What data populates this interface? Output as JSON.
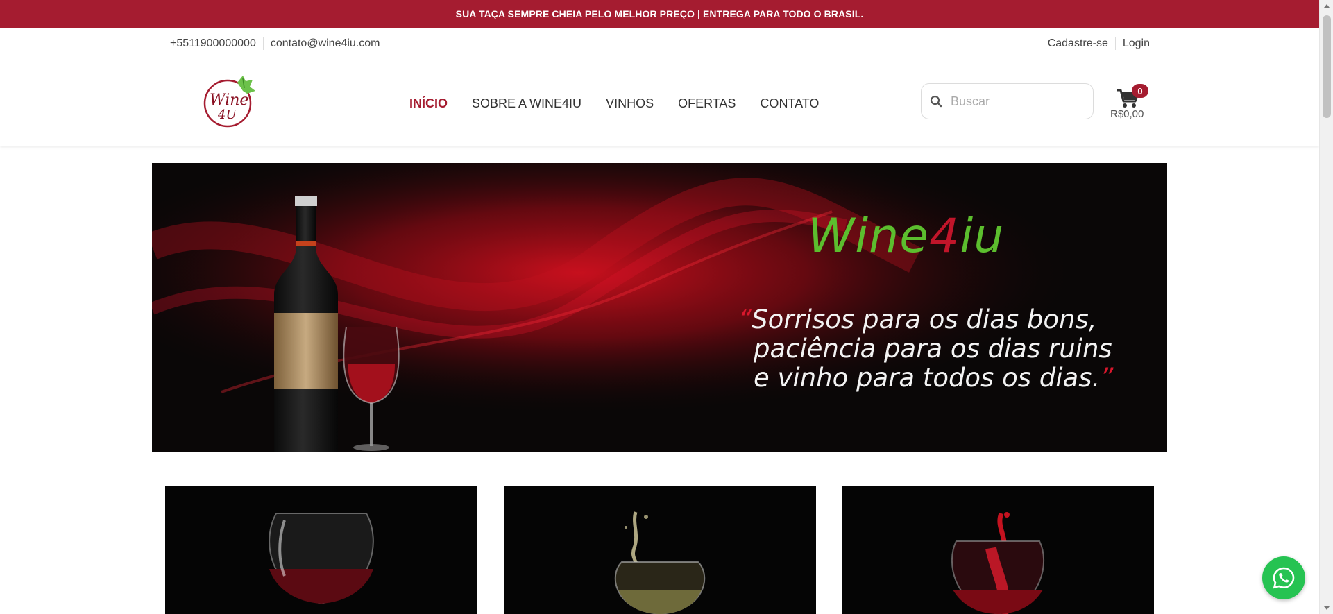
{
  "topbar": {
    "text": "SUA TAÇA SEMPRE CHEIA PELO MELHOR PREÇO | ENTREGA PARA TODO O BRASIL."
  },
  "contact": {
    "phone": "+5511900000000",
    "email": "contato@wine4iu.com"
  },
  "account": {
    "signup": "Cadastre-se",
    "login": "Login"
  },
  "nav": [
    {
      "label": "INÍCIO",
      "active": true
    },
    {
      "label": "SOBRE A WINE4IU",
      "active": false
    },
    {
      "label": "VINHOS",
      "active": false
    },
    {
      "label": "OFERTAS",
      "active": false
    },
    {
      "label": "CONTATO",
      "active": false
    }
  ],
  "search": {
    "placeholder": "Buscar"
  },
  "cart": {
    "count": "0",
    "total": "R$0,00"
  },
  "banner": {
    "brand_prefix": "Wine",
    "brand_four": "4",
    "brand_suffix": "iu",
    "quote_open": "“",
    "quote_line1": "Sorrisos para os dias bons,",
    "quote_line2": "paciência para os dias ruins",
    "quote_line3": "e vinho para todos os dias.",
    "quote_close": "”"
  },
  "colors": {
    "brand_red": "#a51c30",
    "brand_green": "#5cbe2e",
    "whatsapp_green": "#26c352"
  },
  "icons": {
    "search": "search-icon",
    "cart": "cart-icon",
    "whatsapp": "whatsapp-icon",
    "logo": "wine4iu-logo"
  }
}
